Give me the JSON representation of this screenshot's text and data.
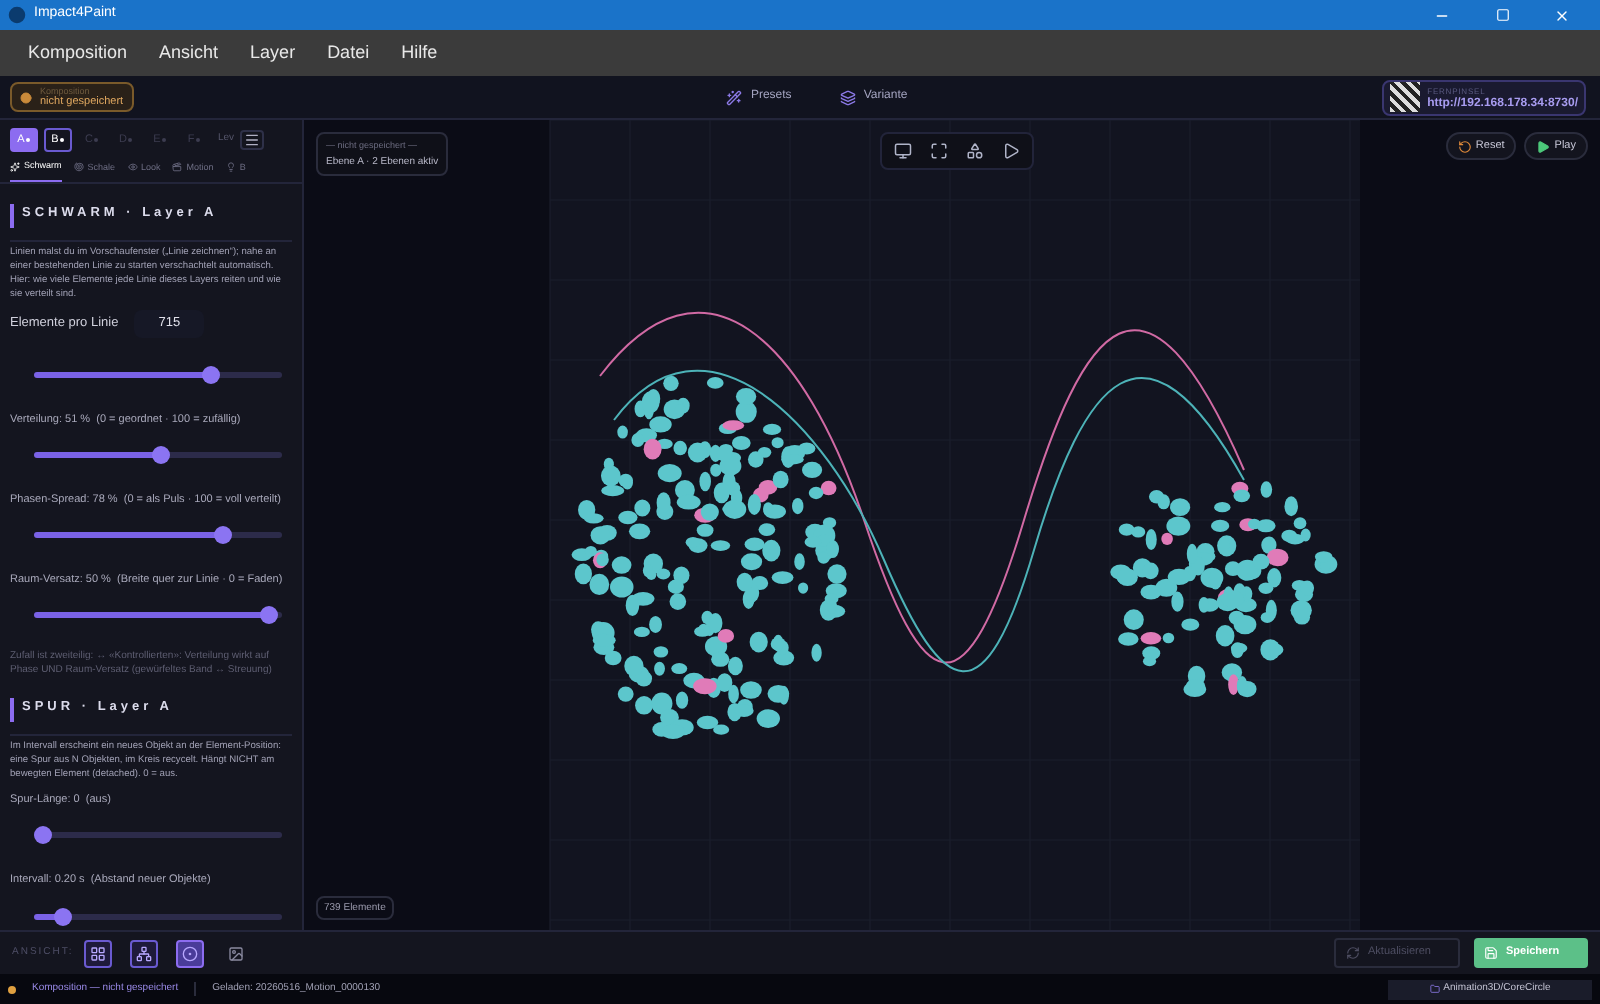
{
  "window": {
    "title": "Impact4Paint"
  },
  "menu": [
    "Komposition",
    "Ansicht",
    "Layer",
    "Datei",
    "Hilfe"
  ],
  "save_badge": {
    "label": "Komposition",
    "status": "nicht gespeichert"
  },
  "toolbar": [
    {
      "kind": "presets",
      "label": "Presets"
    },
    {
      "kind": "variant",
      "label": "Variante"
    }
  ],
  "remote": {
    "label": "FERNPINSEL",
    "url": "http://192.168.178.34:8730/"
  },
  "layer_tabs": [
    {
      "label": "A",
      "selected": true,
      "disabled": false
    },
    {
      "label": "B",
      "selected": false,
      "disabled": false
    },
    {
      "label": "C",
      "selected": false,
      "disabled": true
    },
    {
      "label": "D",
      "selected": false,
      "disabled": true
    },
    {
      "label": "E",
      "selected": false,
      "disabled": true
    },
    {
      "label": "F",
      "selected": false,
      "disabled": true
    }
  ],
  "layer_menu_label": "Lev",
  "sub_tabs": [
    {
      "kind": "swarm",
      "label": "Schwarm",
      "selected": true
    },
    {
      "kind": "shell",
      "label": "Schale",
      "selected": false
    },
    {
      "kind": "look",
      "label": "Look",
      "selected": false
    },
    {
      "kind": "motion",
      "label": "Motion",
      "selected": false
    },
    {
      "kind": "bulb",
      "label": "B",
      "selected": false
    }
  ],
  "sections": [
    {
      "title": "SCHWARM · Layer A",
      "description": "Linien malst du im Vorschaufenster („Linie zeichnen“); nahe an einer bestehenden Linie zu starten verschachtelt automatisch. Hier: wie viele Elemente jede Linie dieses Layers reiten und wie sie verteilt sind.",
      "controls": [
        {
          "kind": "number",
          "label": "Elemente pro Linie",
          "value": "715"
        },
        {
          "kind": "slider",
          "level": 0.73
        },
        {
          "kind": "slider",
          "label": "Verteilung: 51 %  (0 = geordnet · 100 = zufällig)",
          "level": 0.51
        },
        {
          "kind": "slider",
          "label": "Phasen-Spread: 78 %  (0 = als Puls · 100 = voll verteilt)",
          "level": 0.78
        },
        {
          "kind": "slider",
          "label": "Raum-Versatz: 50 %  (Breite quer zur Linie · 0 = Faden)",
          "level": 0.98
        },
        {
          "kind": "note",
          "label": "Zufall ist zweiteilig: ↔ «Kontrollierten»: Verteilung wirkt auf Phase UND Raum-Versatz (gewürfeltes Band ↔ Streuung)"
        }
      ]
    },
    {
      "title": "SPUR · Layer A",
      "description": "Im Intervall erscheint ein neues Objekt an der Element-Position: eine Spur aus N Objekten, im Kreis recycelt. Hängt NICHT am bewegten Element (detached). 0 = aus.",
      "controls": [
        {
          "kind": "slider",
          "label": "Spur-Länge: 0  (aus)",
          "level": 0
        },
        {
          "kind": "slider",
          "label": "Intervall: 0.20 s  (Abstand neuer Objekte)",
          "level": 0.09
        }
      ]
    }
  ],
  "canvas": {
    "info_status": "— nicht gespeichert —",
    "info_layers": "Ebene A · 2 Ebenen aktiv",
    "count": "739 Elemente",
    "buttons": [
      {
        "kind": "reset",
        "label": "Reset"
      },
      {
        "kind": "play",
        "label": "Play"
      }
    ]
  },
  "view": {
    "label": "ANSICHT:",
    "buttons": [
      {
        "kind": "grid",
        "selected": false
      },
      {
        "kind": "nodes",
        "selected": false
      },
      {
        "kind": "target",
        "selected": true
      },
      {
        "kind": "image",
        "selected": false
      }
    ]
  },
  "actions": [
    {
      "kind": "refresh",
      "label": "Aktualisieren",
      "disabled": true
    },
    {
      "kind": "save",
      "label": "Speichern",
      "disabled": false
    }
  ],
  "status_bar": {
    "composition": "Komposition — nicht gespeichert",
    "loaded": "Geladen: 20260516_Motion_0000130",
    "path": "Animation3D/CoreCircle"
  }
}
